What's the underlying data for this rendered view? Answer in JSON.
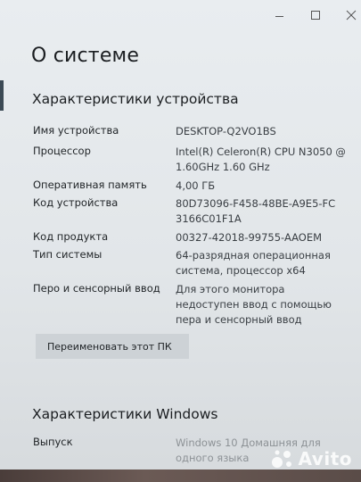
{
  "page": {
    "title": "О системе"
  },
  "device_specs": {
    "section_title": "Характеристики устройства",
    "rows": [
      {
        "label": "Имя устройства",
        "value": "DESKTOP-Q2VO1BS"
      },
      {
        "label": "Процессор",
        "value": "Intel(R) Celeron(R) CPU  N3050  @ 1.60GHz   1.60 GHz"
      },
      {
        "label": "Оперативная память",
        "value": "4,00 ГБ"
      },
      {
        "label": "Код устройства",
        "value": "80D73096-F458-48BE-A9E5-FC3166C01F1A"
      },
      {
        "label": "Код продукта",
        "value": "00327-42018-99755-AAOEM"
      },
      {
        "label": "Тип системы",
        "value": "64-разрядная операционная система, процессор x64"
      },
      {
        "label": "Перо и сенсорный ввод",
        "value": "Для этого монитора недоступен ввод с помощью пера и сенсорный ввод"
      }
    ],
    "rename_button": "Переименовать этот ПК"
  },
  "windows_specs": {
    "section_title": "Характеристики Windows",
    "rows": [
      {
        "label": "Выпуск",
        "value": "Windows 10 Домашняя для одного языка"
      }
    ]
  },
  "watermark": {
    "text": "Avito"
  },
  "colors": {
    "background": "#e2e6e9",
    "button": "#cdd2d6",
    "accent": "#3c4a55"
  }
}
